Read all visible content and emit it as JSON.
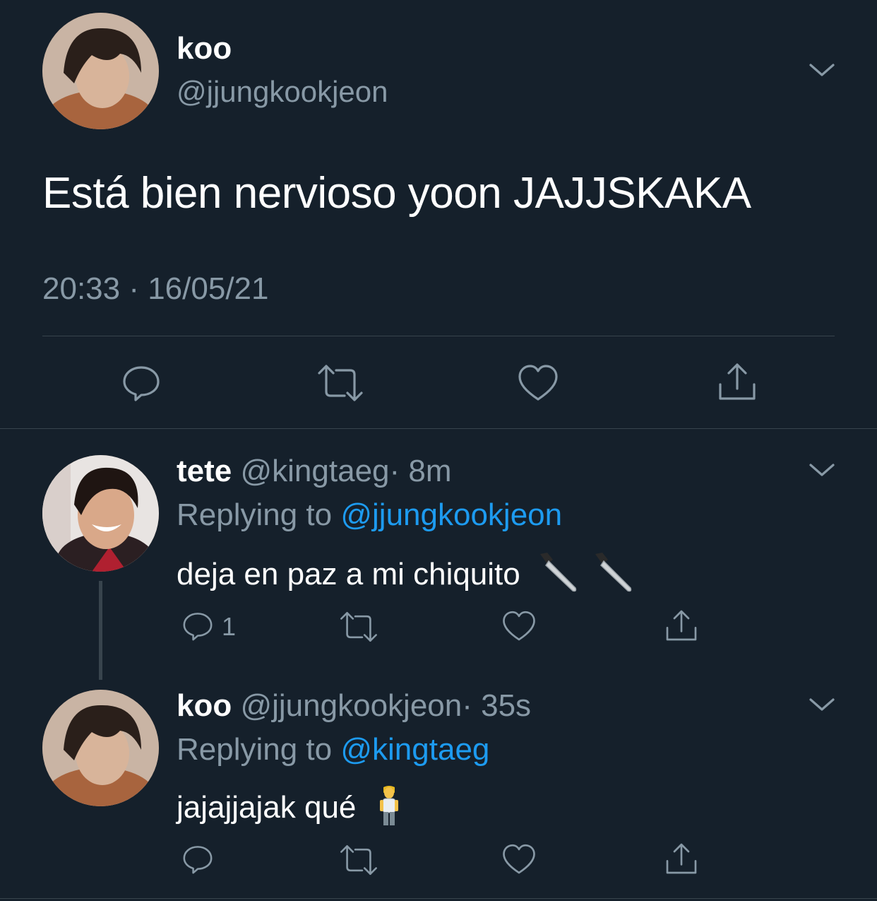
{
  "main_tweet": {
    "display_name": "koo",
    "handle": "@jjungkookjeon",
    "text": "Está bien nervioso yoon JAJJSKAKA",
    "timestamp": "20:33 · 16/05/21"
  },
  "replies": [
    {
      "display_name": "tete",
      "handle": "@kingtaeg",
      "time": "· 8m",
      "replying_prefix": "Replying to ",
      "replying_to": "@jjungkookjeon",
      "text": "deja en paz a mi chiquito",
      "emoji": [
        "kitchen-knife-icon",
        "kitchen-knife-icon"
      ],
      "reply_count": "1"
    },
    {
      "display_name": "koo",
      "handle": "@jjungkookjeon",
      "time": "· 35s",
      "replying_prefix": "Replying to ",
      "replying_to": "@kingtaeg",
      "text": "jajajjajak qué",
      "emoji": [
        "standing-person-icon"
      ],
      "reply_count": ""
    }
  ],
  "colors": {
    "background": "#15202b",
    "secondary_text": "#8899a6",
    "link": "#1d9bf0",
    "divider": "#38444d"
  }
}
